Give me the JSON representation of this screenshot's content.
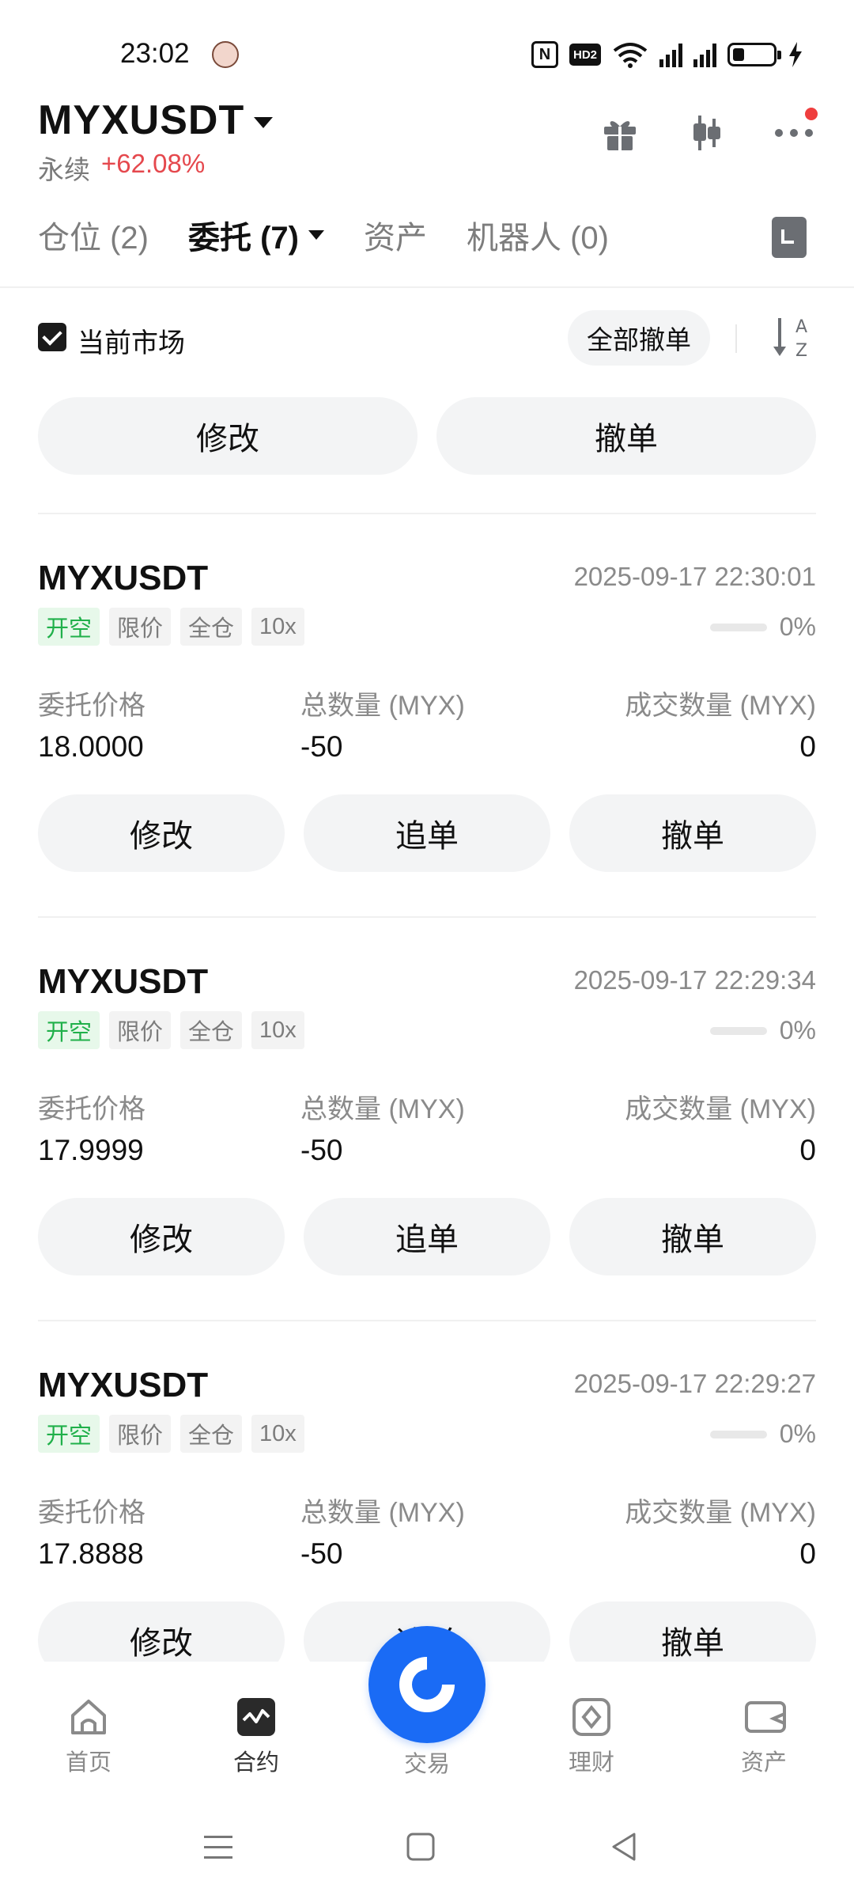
{
  "status_bar": {
    "time": "23:02",
    "icons": [
      "avatar-icon",
      "nfc-icon",
      "hd-icon",
      "wifi-icon",
      "signal-5g-icon",
      "signal-5g-icon",
      "battery-icon",
      "charging-icon"
    ],
    "hd_label": "HD2",
    "nfc_label": "N"
  },
  "header": {
    "symbol": "MYXUSDT",
    "contract_type": "永续",
    "change": "+62.08%",
    "icons": [
      "gift-icon",
      "candlestick-icon",
      "more-icon"
    ]
  },
  "tabs": [
    {
      "label": "仓位 (2)"
    },
    {
      "label": "委托 (7)"
    },
    {
      "label": "资产"
    },
    {
      "label": "机器人 (0)"
    }
  ],
  "filter": {
    "current_market_label": "当前市场",
    "current_market_checked": true,
    "cancel_all_label": "全部撤单"
  },
  "batch_actions": {
    "modify_label": "修改",
    "cancel_label": "撤单"
  },
  "orders": [
    {
      "symbol": "MYXUSDT",
      "time": "2025-09-17 22:30:01",
      "tags": [
        "开空",
        "限价",
        "全仓",
        "10x"
      ],
      "fill_percent": 0,
      "fill_text": "0%",
      "price_label": "委托价格",
      "price": "18.0000",
      "qty_label": "总数量 (MYX)",
      "qty": "-50",
      "filled_label": "成交数量 (MYX)",
      "filled": "0",
      "actions": [
        "修改",
        "追单",
        "撤单"
      ]
    },
    {
      "symbol": "MYXUSDT",
      "time": "2025-09-17 22:29:34",
      "tags": [
        "开空",
        "限价",
        "全仓",
        "10x"
      ],
      "fill_percent": 0,
      "fill_text": "0%",
      "price_label": "委托价格",
      "price": "17.9999",
      "qty_label": "总数量 (MYX)",
      "qty": "-50",
      "filled_label": "成交数量 (MYX)",
      "filled": "0",
      "actions": [
        "修改",
        "追单",
        "撤单"
      ]
    },
    {
      "symbol": "MYXUSDT",
      "time": "2025-09-17 22:29:27",
      "tags": [
        "开空",
        "限价",
        "全仓",
        "10x"
      ],
      "fill_percent": 0,
      "fill_text": "0%",
      "price_label": "委托价格",
      "price": "17.8888",
      "qty_label": "总数量 (MYX)",
      "qty": "-50",
      "filled_label": "成交数量 (MYX)",
      "filled": "0",
      "actions": [
        "修改",
        "追单",
        "撤单"
      ]
    }
  ],
  "bottom_nav": {
    "items": [
      {
        "label": "首页",
        "icon": "home-icon"
      },
      {
        "label": "合约",
        "icon": "futures-icon"
      },
      {
        "label": "交易",
        "icon": "trade-icon"
      },
      {
        "label": "理财",
        "icon": "earn-icon"
      },
      {
        "label": "资产",
        "icon": "wallet-icon"
      }
    ],
    "active": "合约"
  },
  "colors": {
    "up": "#e5484d",
    "tag_green": "#20b04a",
    "accent_blue": "#1a6bf5",
    "pill_bg": "#f3f4f5"
  }
}
